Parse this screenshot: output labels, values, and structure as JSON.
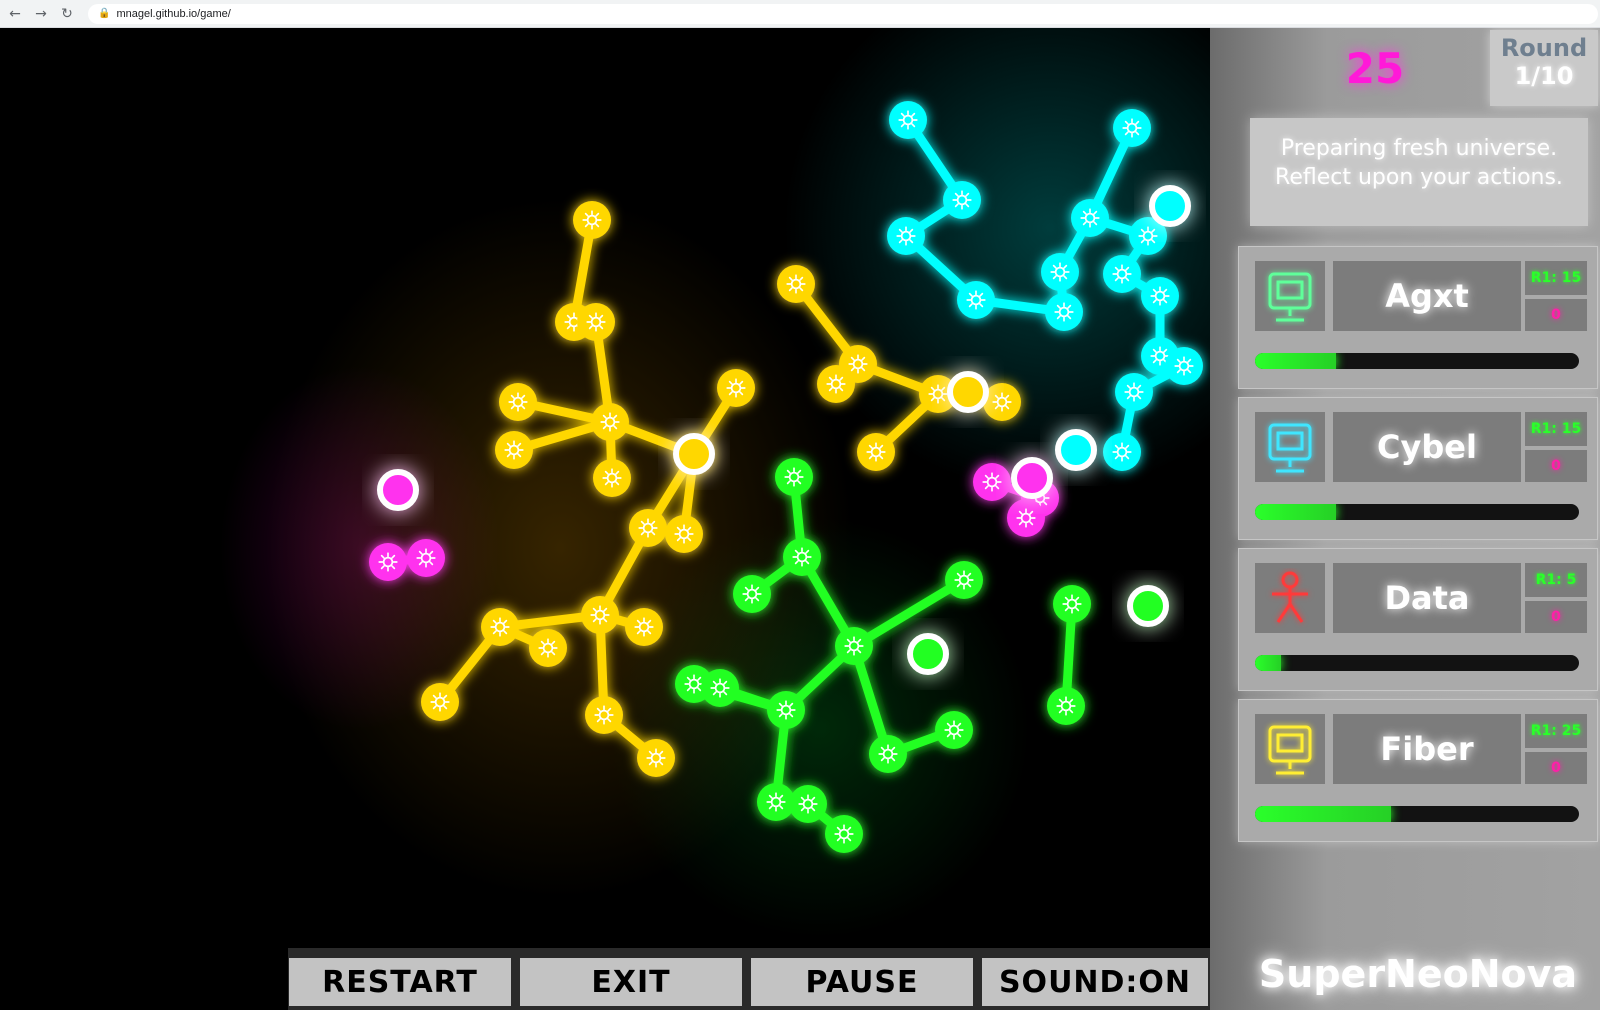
{
  "browser": {
    "url": "mnagel.github.io/game/"
  },
  "hud": {
    "score": "25",
    "round_label": "Round",
    "round_value": "1/10",
    "message_line1": "Preparing fresh universe.",
    "message_line2": "Reflect upon your actions."
  },
  "players": [
    {
      "name": "Agxt",
      "round_score": "R1: 15",
      "kills": "0",
      "color": "#00ffff",
      "icon": "robot-head-icon",
      "progress": 0.25
    },
    {
      "name": "Cybel",
      "round_score": "R1: 15",
      "kills": "0",
      "color": "#00e5ff",
      "icon": "robot-head-icon",
      "progress": 0.25
    },
    {
      "name": "Data",
      "round_score": "R1: 5",
      "kills": "0",
      "color": "#ff3030",
      "icon": "humanoid-figure-icon",
      "progress": 0.08
    },
    {
      "name": "Fiber",
      "round_score": "R1: 25",
      "kills": "0",
      "color": "#ffee00",
      "icon": "robot-head-icon",
      "progress": 0.42
    }
  ],
  "buttons": {
    "restart": "RESTART",
    "exit": "EXIT",
    "pause": "PAUSE",
    "sound": "SOUND:ON"
  },
  "brand": "SuperNeoNova",
  "colors": {
    "yellow": "#ffd700",
    "cyan": "#00ffff",
    "green": "#22ff22",
    "magenta": "#ff33ee",
    "score": "#ff19d8"
  }
}
